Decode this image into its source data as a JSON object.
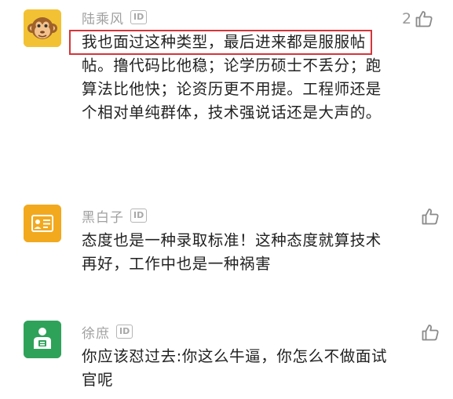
{
  "comments": [
    {
      "username": "陆乘风",
      "badge": "ID",
      "avatar_icon": "monkey-face-icon",
      "likes": "2",
      "text": "我也面过这种类型，最后进来都是服服帖帖。撸代码比他稳；论学历硕士不丢分；跑算法比他快；论资历更不用提。工程师还是个相对单纯群体，技术强说话还是大声的。"
    },
    {
      "username": "黑白子",
      "badge": "ID",
      "avatar_icon": "id-card-person-icon",
      "likes": "",
      "text": "态度也是一种录取标准！这种态度就算技术再好，工作中也是一种祸害"
    },
    {
      "username": "徐庶",
      "badge": "ID",
      "avatar_icon": "person-badge-icon",
      "likes": "",
      "text": "你应该怼过去:你这么牛逼，你怎么不做面试官呢"
    }
  ],
  "colors": {
    "highlight": "#d4353a",
    "avatar_1_bg": "#f3c234",
    "avatar_2_bg": "#f2a91e",
    "avatar_3_bg": "#2fa25a",
    "username": "#a0a0a0",
    "body_text": "#222222"
  }
}
